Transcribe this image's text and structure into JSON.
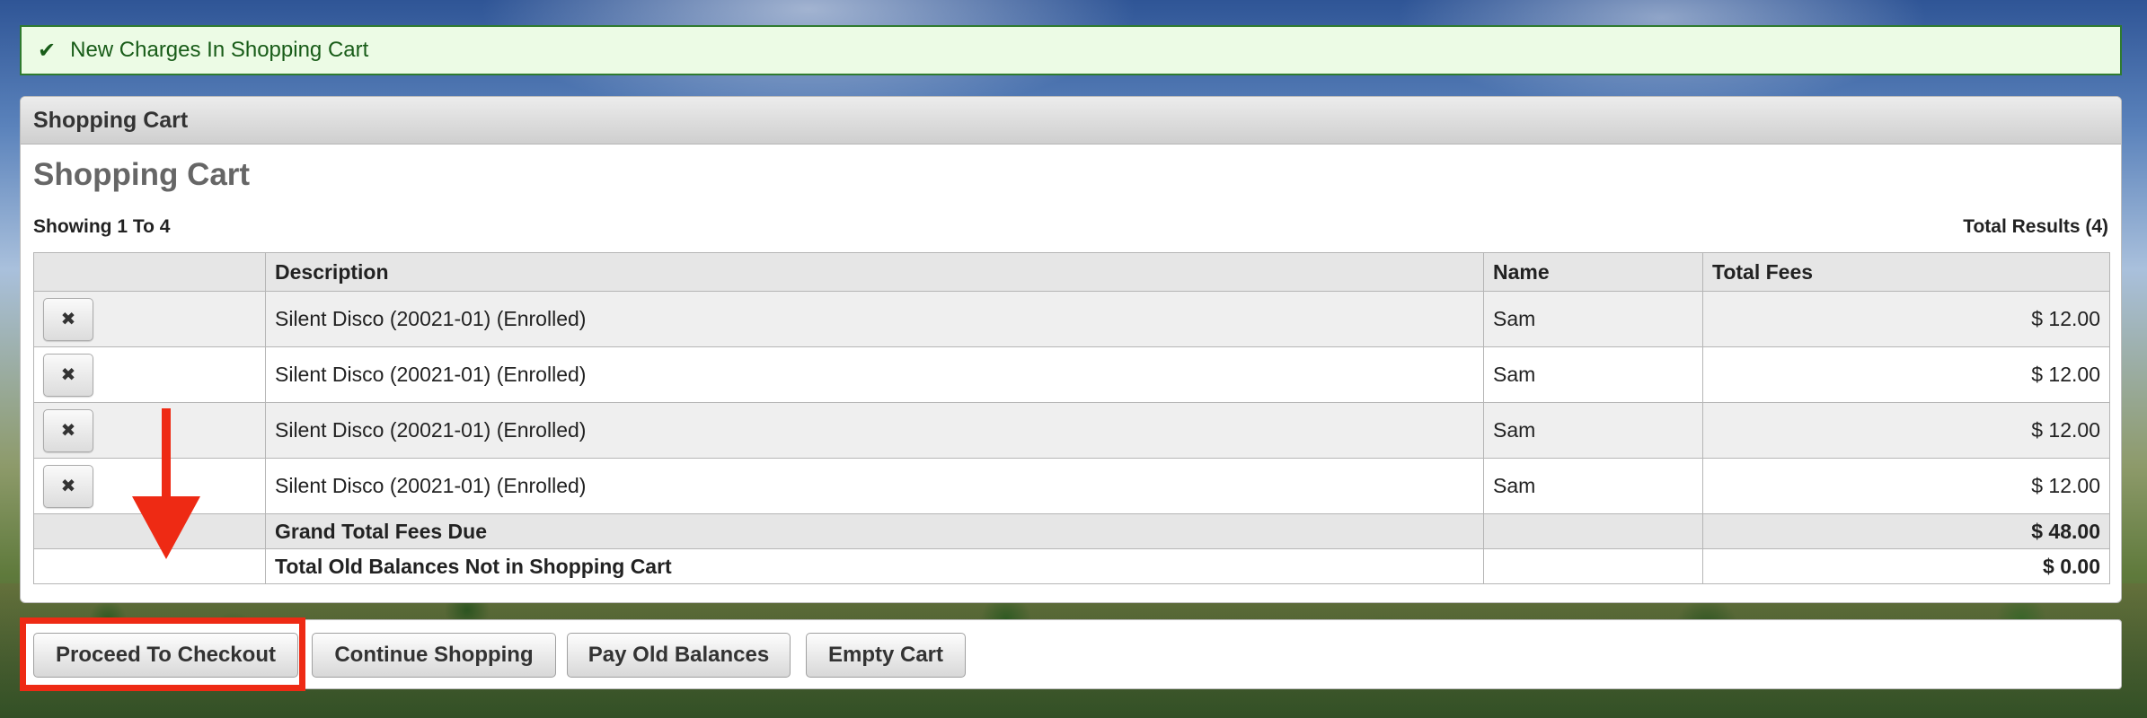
{
  "alert": {
    "icon": "check-icon",
    "text": "New Charges In Shopping Cart"
  },
  "panel": {
    "header": "Shopping Cart",
    "title": "Shopping Cart",
    "showing": "Showing 1 To 4",
    "total_results": "Total Results (4)"
  },
  "table": {
    "headers": [
      "",
      "Description",
      "Name",
      "Total Fees"
    ],
    "rows": [
      {
        "remove_icon": "close-icon",
        "description": "Silent Disco (20021-01) (Enrolled)",
        "name": "Sam",
        "fee": "$ 12.00"
      },
      {
        "remove_icon": "close-icon",
        "description": "Silent Disco (20021-01) (Enrolled)",
        "name": "Sam",
        "fee": "$ 12.00"
      },
      {
        "remove_icon": "close-icon",
        "description": "Silent Disco (20021-01) (Enrolled)",
        "name": "Sam",
        "fee": "$ 12.00"
      },
      {
        "remove_icon": "close-icon",
        "description": "Silent Disco (20021-01) (Enrolled)",
        "name": "Sam",
        "fee": "$ 12.00"
      }
    ],
    "grand_total_label": "Grand Total Fees Due",
    "grand_total_value": "$ 48.00",
    "old_balances_label": "Total Old Balances Not in Shopping Cart",
    "old_balances_value": "$ 0.00"
  },
  "buttons": {
    "checkout": "Proceed To Checkout",
    "continue": "Continue Shopping",
    "pay_old": "Pay Old Balances",
    "empty": "Empty Cart"
  },
  "annotation_color": "#ee2a14"
}
